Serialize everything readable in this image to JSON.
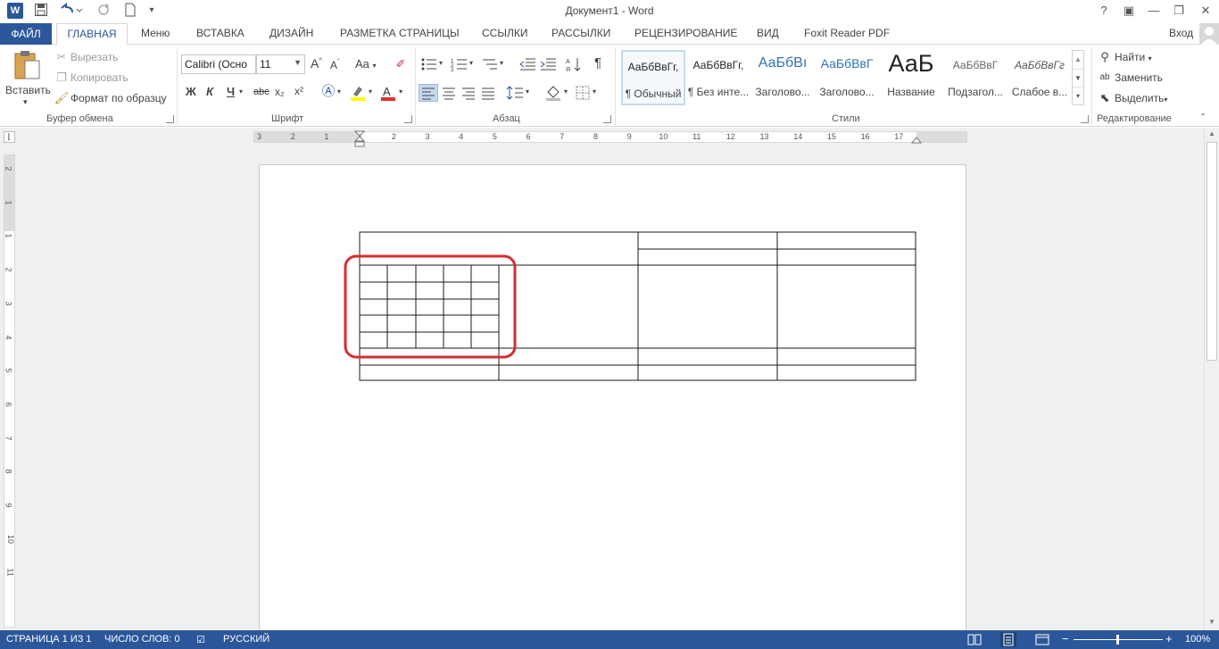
{
  "window": {
    "title": "Документ1 - Word",
    "controls": {
      "help": "?",
      "ribbon_opts": "▣",
      "minimize": "—",
      "restore": "❐",
      "close": "✕"
    }
  },
  "qat": {
    "word_icon": "W",
    "save_icon": "save-icon",
    "undo_icon": "undo-icon",
    "redo_icon": "redo-icon",
    "new_icon": "new-doc-icon"
  },
  "tabs": {
    "file": "ФАЙЛ",
    "home": "ГЛАВНАЯ",
    "menu": "Меню",
    "insert": "ВСТАВКА",
    "design": "ДИЗАЙН",
    "layout": "РАЗМЕТКА СТРАНИЦЫ",
    "references": "ССЫЛКИ",
    "mailings": "РАССЫЛКИ",
    "review": "РЕЦЕНЗИРОВАНИЕ",
    "view": "ВИД",
    "foxit": "Foxit Reader PDF",
    "signin": "Вход"
  },
  "ribbon": {
    "clipboard": {
      "paste": "Вставить",
      "cut": "Вырезать",
      "copy": "Копировать",
      "format_painter": "Формат по образцу",
      "group": "Буфер обмена"
    },
    "font": {
      "name": "Calibri (Осно",
      "size": "11",
      "bold": "Ж",
      "italic": "К",
      "underline": "Ч",
      "strike": "abc",
      "sub": "x₂",
      "sup": "x²",
      "case": "Aa",
      "grow": "A",
      "shrink": "A",
      "group": "Шрифт"
    },
    "paragraph": {
      "group": "Абзац"
    },
    "styles": {
      "group": "Стили",
      "items": [
        {
          "sample": "АаБбВвГг,",
          "name": "¶ Обычный"
        },
        {
          "sample": "АаБбВвГг,",
          "name": "¶ Без инте..."
        },
        {
          "sample": "АаБбВı",
          "name": "Заголово..."
        },
        {
          "sample": "АаБбВвГ",
          "name": "Заголово..."
        },
        {
          "sample": "АаБ",
          "name": "Название"
        },
        {
          "sample": "АаБбВвГ",
          "name": "Подзагол..."
        },
        {
          "sample": "АаБбВвГг",
          "name": "Слабое в..."
        }
      ]
    },
    "editing": {
      "find": "Найти",
      "replace": "Заменить",
      "select": "Выделить",
      "group": "Редактирование"
    }
  },
  "ruler": {
    "h_ticks": [
      "3",
      "2",
      "1",
      "1",
      "2",
      "3",
      "4",
      "5",
      "6",
      "7",
      "8",
      "9",
      "10",
      "11",
      "12",
      "13",
      "14",
      "15",
      "16",
      "17"
    ],
    "v_ticks": [
      "2",
      "1",
      "1",
      "2",
      "3",
      "4",
      "5",
      "6",
      "7",
      "8",
      "9",
      "10",
      "11"
    ]
  },
  "colors": {
    "accent": "#2b579a",
    "highlight": "#d32f2f",
    "table_line": "#1a1a1a"
  },
  "status": {
    "page": "СТРАНИЦА 1 ИЗ 1",
    "words": "ЧИСЛО СЛОВ: 0",
    "language": "РУССКИЙ",
    "zoom": "100%"
  }
}
